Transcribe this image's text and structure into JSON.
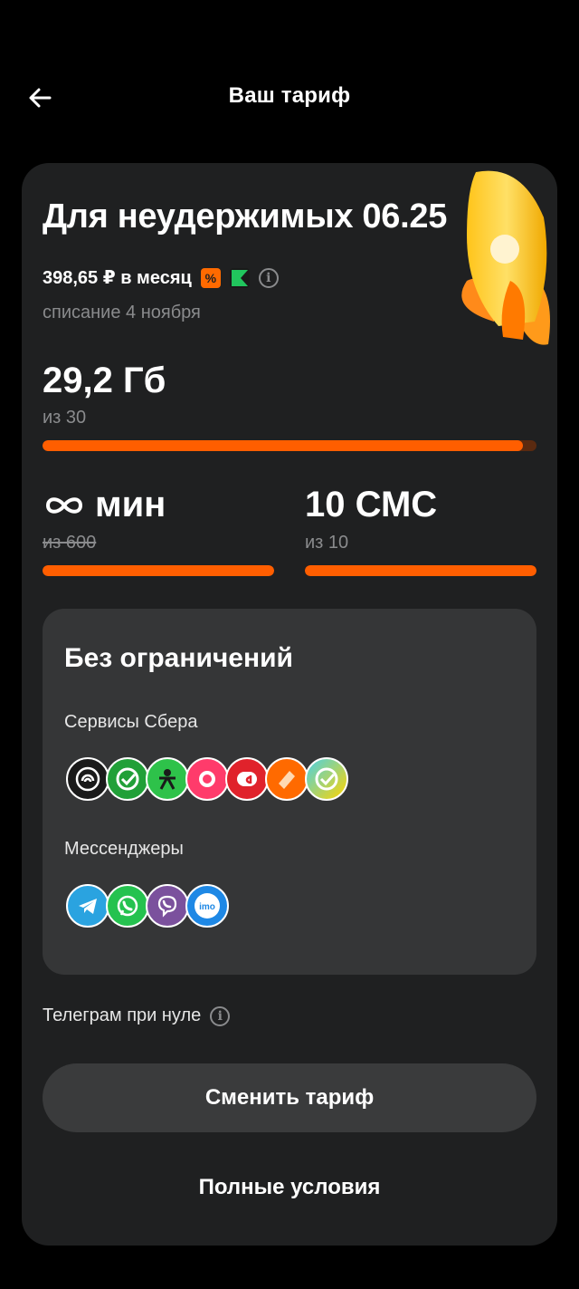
{
  "header": {
    "title": "Ваш тариф"
  },
  "tariff": {
    "name": "Для неудержимых 06.25",
    "price": "398,65 ₽ в месяц",
    "charge_date": "списание 4 ноября",
    "badge_percent": "%"
  },
  "data": {
    "value": "29,2 Гб",
    "of": "из 30",
    "fraction": 0.973
  },
  "minutes": {
    "value": "мин",
    "of": "из 600",
    "fraction": 1.0
  },
  "sms": {
    "value": "10 СМС",
    "of": "из 10",
    "fraction": 1.0
  },
  "unlimited": {
    "title": "Без ограничений",
    "sber_label": "Сервисы Сбера",
    "sber_icons": [
      "sber-podcast-icon",
      "sberbank-icon",
      "okko-people-icon",
      "sber-music-icon",
      "samokat-icon",
      "ticket-icon",
      "sber-check-icon"
    ],
    "messengers_label": "Мессенджеры",
    "messenger_icons": [
      "telegram-icon",
      "whatsapp-icon",
      "viber-icon",
      "imo-icon"
    ],
    "imo_text": "imo"
  },
  "telegram_zero": "Телеграм при нуле",
  "buttons": {
    "change": "Сменить тариф",
    "terms": "Полные условия"
  },
  "colors": {
    "accent": "#ff5e00",
    "card": "#1f2021",
    "inner_card": "#353637",
    "muted": "#8a8b8d"
  }
}
